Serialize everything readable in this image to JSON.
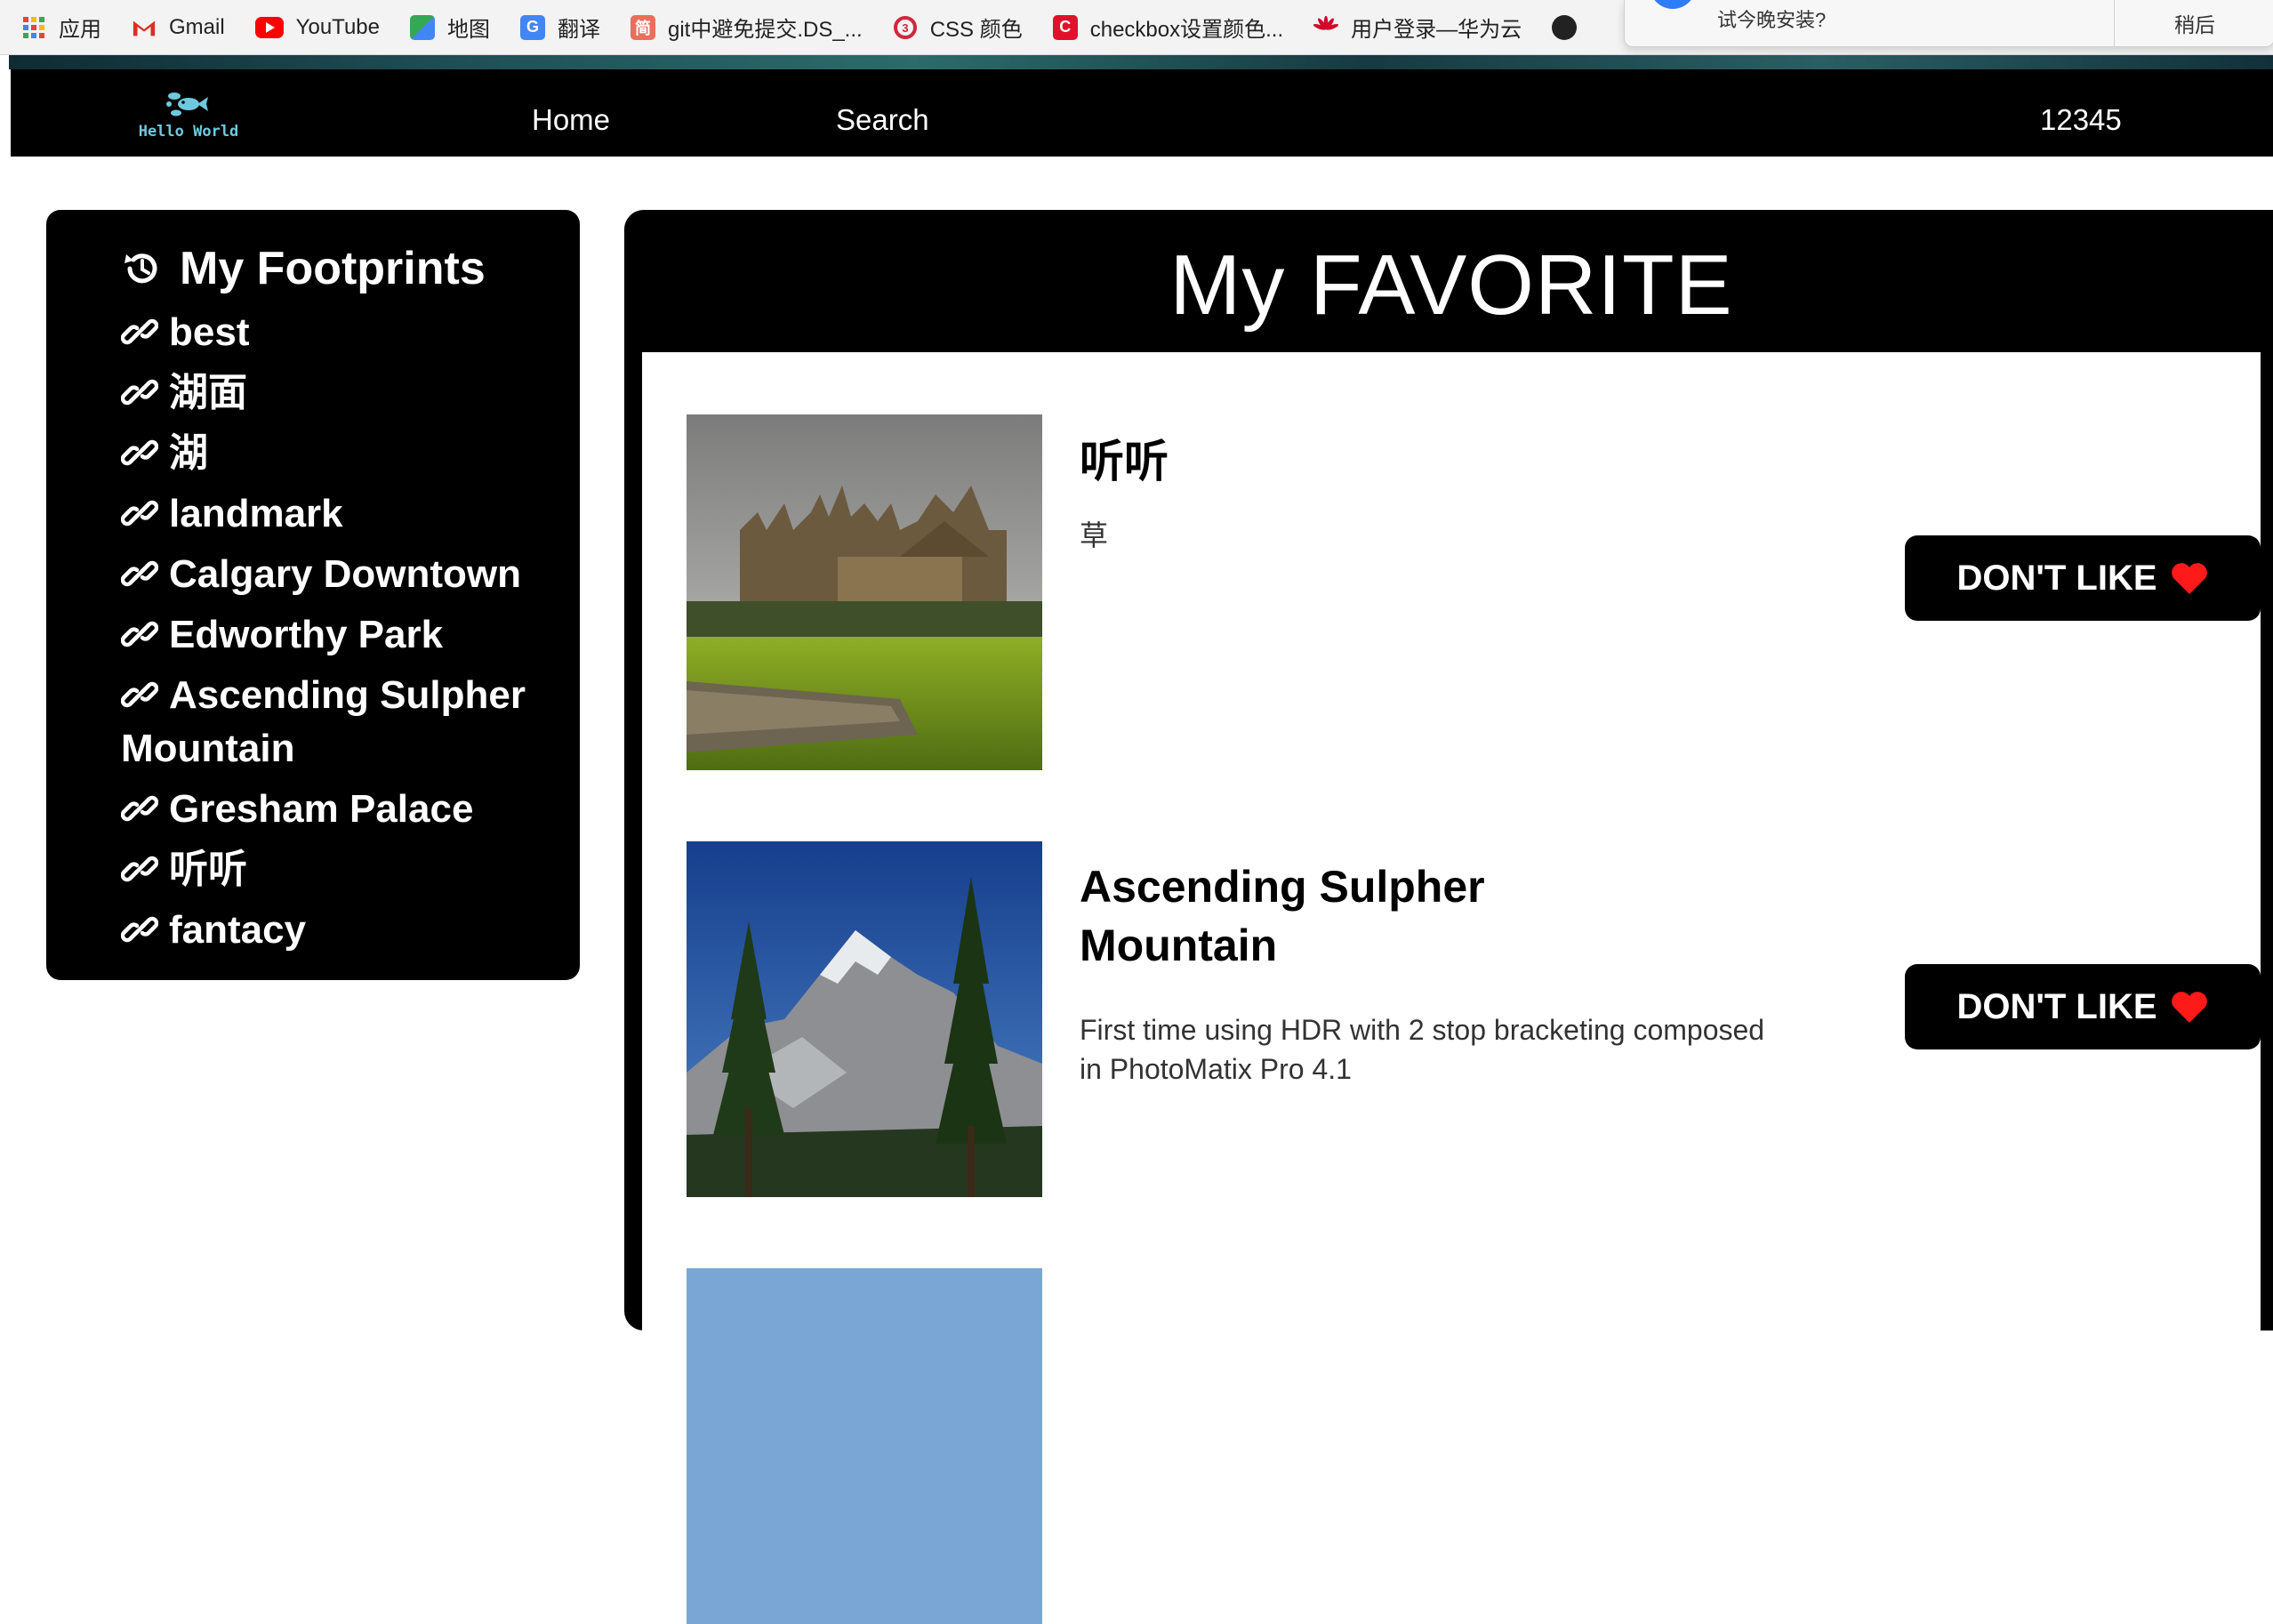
{
  "bookmarks": [
    {
      "label": "应用",
      "icon": "apps-grid-icon",
      "color": "#4285f4"
    },
    {
      "label": "Gmail",
      "icon": "gmail-icon",
      "color": "#d93025"
    },
    {
      "label": "YouTube",
      "icon": "youtube-icon",
      "color": "#ff0000"
    },
    {
      "label": "地图",
      "icon": "maps-icon",
      "color": "#34a853"
    },
    {
      "label": "翻译",
      "icon": "translate-icon",
      "color": "#4285f4"
    },
    {
      "label": "git中避免提交.DS_...",
      "icon": "jianshu-icon",
      "color": "#ea6f5a"
    },
    {
      "label": "CSS 颜色",
      "icon": "w3school-icon",
      "color": "#d0283c"
    },
    {
      "label": "checkbox设置颜色...",
      "icon": "csdn-icon",
      "color": "#e0112b"
    },
    {
      "label": "用户登录—华为云",
      "icon": "huawei-icon",
      "color": "#cf0a2c"
    }
  ],
  "install_popup": {
    "text": "试今晚安装?",
    "later_label": "稍后"
  },
  "navbar": {
    "logo_text": "Hello World",
    "home_label": "Home",
    "search_label": "Search",
    "user_label": "12345"
  },
  "sidebar": {
    "title": "My Footprints",
    "items": [
      "best",
      "湖面",
      "湖",
      "landmark",
      "Calgary Downtown",
      "Edworthy Park",
      "Ascending Sulpher Mountain",
      "Gresham Palace",
      "听听",
      "fantacy"
    ]
  },
  "favorites": {
    "title": "My FAVORITE",
    "button_label": "DON'T LIKE",
    "heart_color": "#ff1a1a",
    "items": [
      {
        "name": "听听",
        "description": "草"
      },
      {
        "name": "Ascending Sulpher Mountain",
        "description": "First time using HDR with 2 stop bracketing composed in PhotoMatix Pro 4.1"
      }
    ]
  }
}
